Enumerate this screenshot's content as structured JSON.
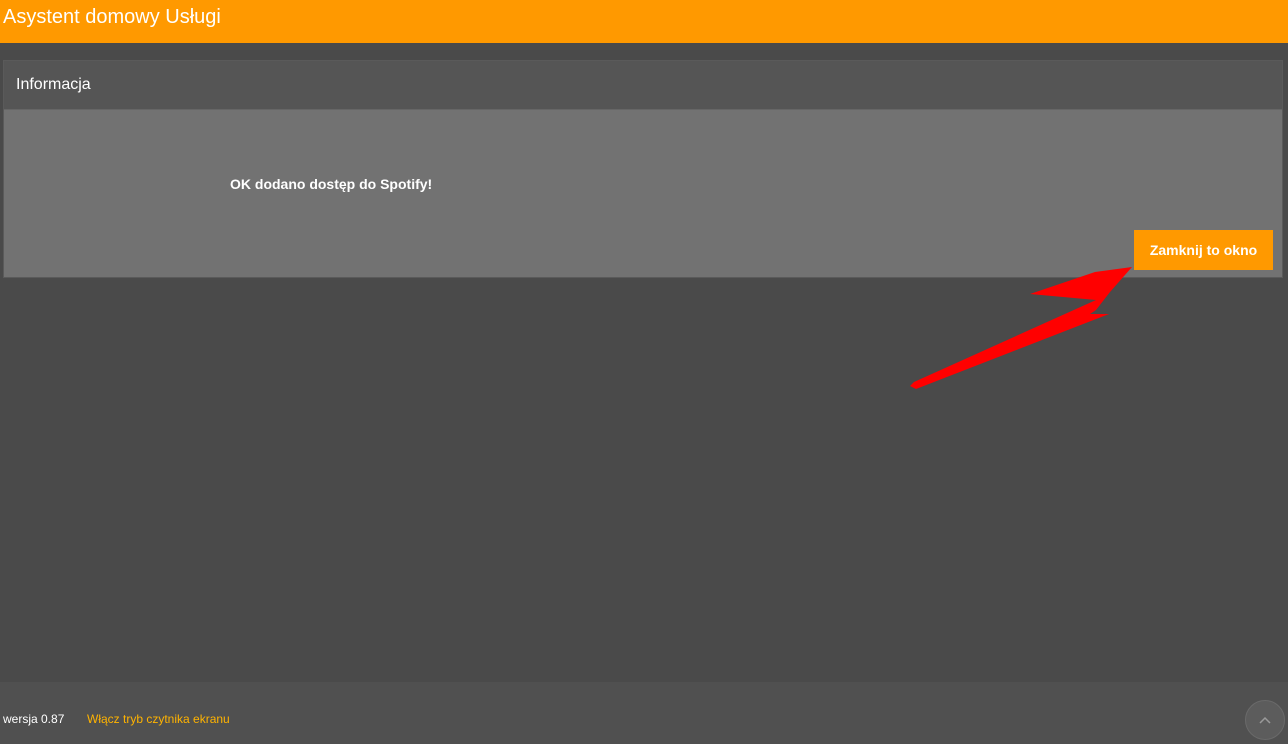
{
  "header": {
    "title": "Asystent domowy Usługi"
  },
  "panel": {
    "title": "Informacja",
    "message": "OK dodano dostęp do Spotify!",
    "close_button_label": "Zamknij to okno"
  },
  "footer": {
    "version": "wersja 0.87",
    "screen_reader_link": "Włącz tryb czytnika ekranu"
  },
  "icons": {
    "scroll_top": "chevron-up-icon",
    "annotation": "arrow-icon"
  },
  "colors": {
    "accent": "#ff9900",
    "background": "#4a4a4a",
    "panel_body": "#727272",
    "panel_header": "#555555",
    "annotation_arrow": "#ff0000"
  }
}
